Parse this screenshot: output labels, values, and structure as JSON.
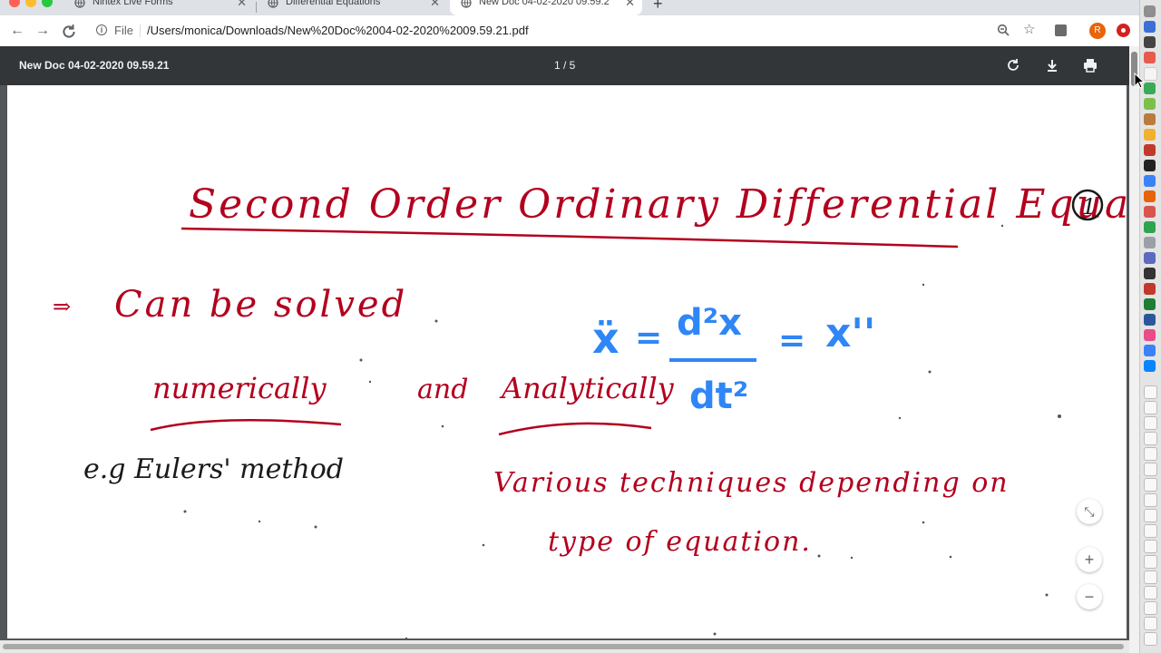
{
  "tabs": [
    {
      "title": "Nintex Live Forms",
      "active": false
    },
    {
      "title": "Differential Equations",
      "active": false
    },
    {
      "title": "New Doc 04-02-2020 09.59.2",
      "active": true
    }
  ],
  "toolbar": {
    "scheme": "File",
    "url": "/Users/monica/Downloads/New%20Doc%2004-02-2020%2009.59.21.pdf",
    "profile_initial": "R"
  },
  "pdf": {
    "title": "New Doc 04-02-2020 09.59.21",
    "page_indicator": "1 / 5"
  },
  "note": {
    "title": "Second Order Ordinary Differential Equations",
    "page_number": "1",
    "bullet": "Can be solved",
    "numerically": "numerically",
    "and": "and",
    "analytically": "Analytically",
    "example": "e.g Eulers' method",
    "techniques_line1": "Various techniques depending on",
    "techniques_line2": "type of equation.",
    "eq_lhs": "ẍ",
    "eq_equals1": "=",
    "eq_numerator": "d²x",
    "eq_denominator": "dt²",
    "eq_equals2": "=",
    "eq_rhs": "x''",
    "ink_red": "#b3001e",
    "ink_dark": "#1a1a1a",
    "ink_blue": "#2f86f6"
  },
  "colors": {
    "accent_profile": "#e8630a",
    "pdf_header": "#323639",
    "pdf_background": "#525659"
  }
}
